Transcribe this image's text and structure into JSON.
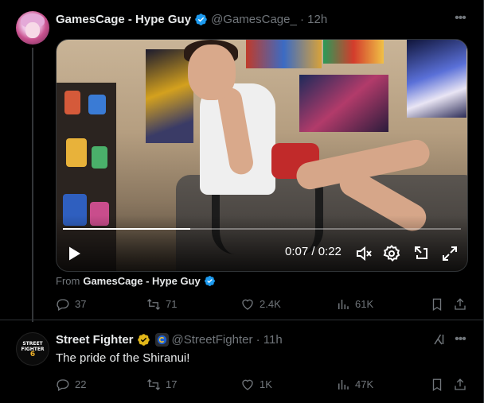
{
  "tweet1": {
    "display_name": "GamesCage - Hype Guy",
    "handle_time": "@GamesCage_ · 12h",
    "video": {
      "timecode": "0:07 / 0:22",
      "progress_fraction": 0.32
    },
    "from_prefix": "From",
    "from_name": "GamesCage - Hype Guy",
    "actions": {
      "replies": "37",
      "reposts": "71",
      "likes": "2.4K",
      "views": "61K"
    }
  },
  "tweet2": {
    "display_name": "Street Fighter",
    "handle_time": "@StreetFighter · 11h",
    "text": "The pride of the Shiranui!",
    "avatar_logo": "STREET FIGHTER 6",
    "actions": {
      "replies": "22",
      "reposts": "17",
      "likes": "1K",
      "views": "47K"
    }
  },
  "colors": {
    "background": "#000000",
    "text_primary": "#e7e9ea",
    "text_secondary": "#71767b",
    "verified_blue": "#1d9bf0",
    "verified_gold": "#e2b719",
    "divider": "#2f3336"
  },
  "icons": {
    "more": "more-icon",
    "reply": "reply-icon",
    "repost": "repost-icon",
    "like": "heart-icon",
    "views": "views-icon",
    "bookmark": "bookmark-icon",
    "share": "share-icon",
    "grok": "grok-icon"
  }
}
